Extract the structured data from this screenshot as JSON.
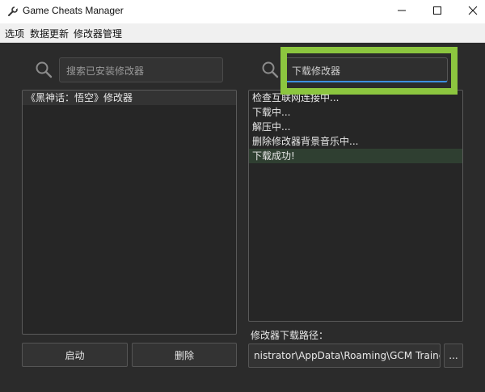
{
  "window": {
    "title": "Game Cheats Manager",
    "icon": "wrench-icon",
    "controls": [
      "minimize-icon",
      "maximize-icon",
      "close-icon"
    ]
  },
  "menu": {
    "items": [
      "选项",
      "数据更新",
      "修改器管理"
    ]
  },
  "left": {
    "search_placeholder": "搜索已安装修改器",
    "installed": [
      "《黑神话：悟空》修改器"
    ],
    "launch_label": "启动",
    "delete_label": "删除"
  },
  "right": {
    "search_placeholder": "下载修改器",
    "log": [
      "检查互联网连接中...",
      "下载中...",
      "解压中...",
      "删除修改器背景音乐中...",
      "下载成功!"
    ],
    "path_label": "修改器下载路径：",
    "path_value": "nistrator\\AppData\\Roaming\\GCM Trainers",
    "browse_label": "..."
  },
  "colors": {
    "highlight": "#8cc63f",
    "accent": "#3d8ee0",
    "background": "#2b2b2b"
  }
}
